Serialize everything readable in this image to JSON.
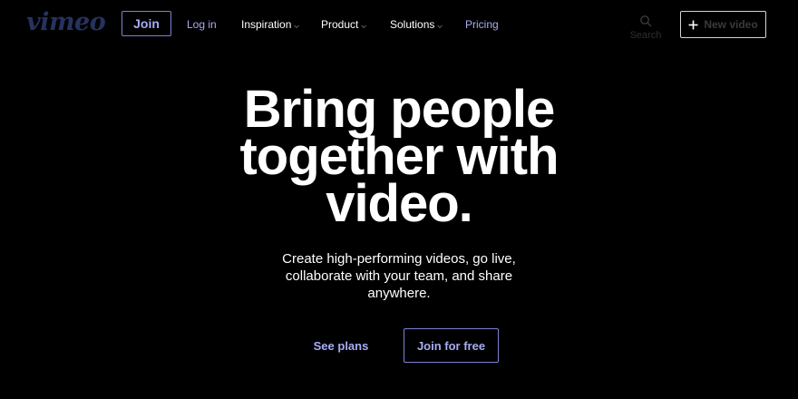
{
  "header": {
    "logo_text": "vimeo",
    "join_label": "Join",
    "nav": {
      "login": "Log in",
      "inspiration": "Inspiration",
      "product": "Product",
      "solutions": "Solutions",
      "pricing": "Pricing"
    },
    "search_label": "Search",
    "new_video_label": "New video"
  },
  "hero": {
    "title_lines": [
      "Bring people",
      "together with",
      "video."
    ],
    "subtitle_lines": [
      "Create high-performing videos, go live,",
      "collaborate with your team, and share",
      "anywhere."
    ],
    "see_plans_label": "See plans",
    "join_free_label": "Join for free"
  },
  "colors": {
    "background": "#000000",
    "accent": "#a7acf5",
    "accent_border": "#7d82d4",
    "logo": "#26325f",
    "text": "#ffffff"
  },
  "icons": {
    "dropdown": "chevron-down-icon",
    "search": "search-icon",
    "new_video": "plus-icon"
  }
}
